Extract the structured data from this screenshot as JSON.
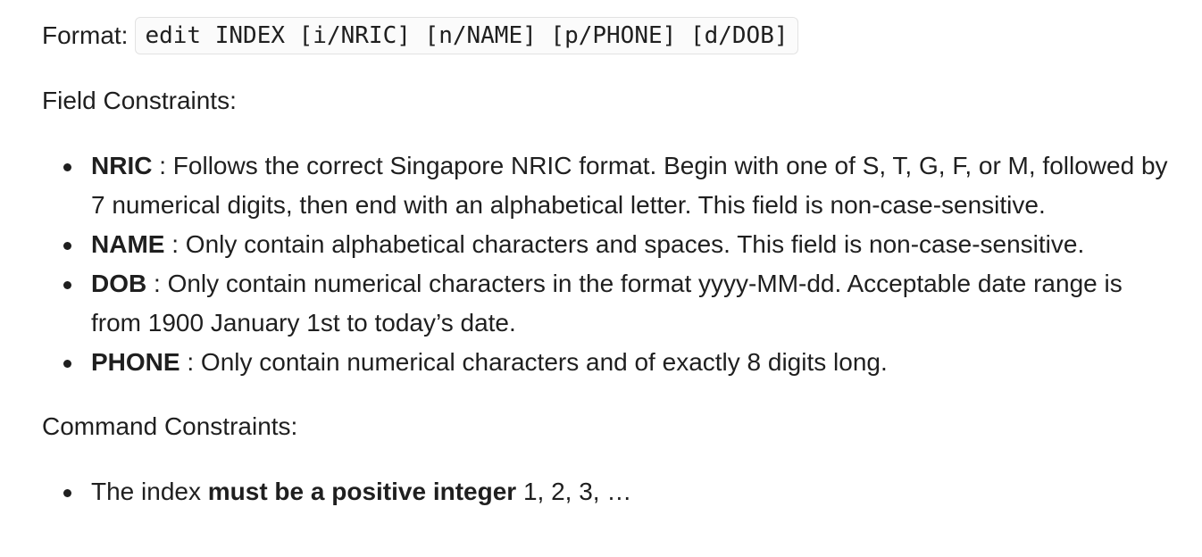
{
  "format": {
    "label": "Format:",
    "code": "edit INDEX [i/NRIC] [n/NAME] [p/PHONE] [d/DOB]"
  },
  "field_constraints": {
    "title": "Field Constraints:",
    "items": [
      {
        "key": "NRIC",
        "text": " : Follows the correct Singapore NRIC format. Begin with one of S, T, G, F, or M, followed by 7 numerical digits, then end with an alphabetical letter. This field is non-case-sensitive."
      },
      {
        "key": "NAME",
        "text": " : Only contain alphabetical characters and spaces. This field is non-case-sensitive."
      },
      {
        "key": "DOB",
        "text": " : Only contain numerical characters in the format yyyy-MM-dd. Acceptable date range is from 1900 January 1st to today’s date."
      },
      {
        "key": "PHONE",
        "text": " : Only contain numerical characters and of exactly 8 digits long."
      }
    ]
  },
  "command_constraints": {
    "title": "Command Constraints:",
    "items": [
      {
        "prefix": "The index ",
        "strong": "must be a positive integer",
        "suffix": " 1, 2, 3, …"
      }
    ]
  }
}
